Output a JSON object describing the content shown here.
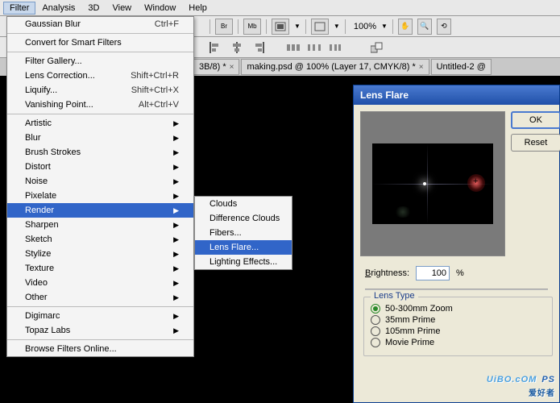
{
  "menubar": {
    "items": [
      "Filter",
      "Analysis",
      "3D",
      "View",
      "Window",
      "Help"
    ],
    "selected": 0
  },
  "toolbar": {
    "buttons": [
      "Br",
      "Mb"
    ],
    "zoom": "100%"
  },
  "doctabs": {
    "tabs": [
      {
        "label": "3B/8) *"
      },
      {
        "label": "making.psd @ 100% (Layer 17, CMYK/8) *"
      },
      {
        "label": "Untitled-2 @"
      }
    ]
  },
  "filter_menu": {
    "last": {
      "label": "Gaussian Blur",
      "shortcut": "Ctrl+F"
    },
    "convert": "Convert for Smart Filters",
    "sec2": [
      {
        "label": "Filter Gallery..."
      },
      {
        "label": "Lens Correction...",
        "shortcut": "Shift+Ctrl+R"
      },
      {
        "label": "Liquify...",
        "shortcut": "Shift+Ctrl+X"
      },
      {
        "label": "Vanishing Point...",
        "shortcut": "Alt+Ctrl+V"
      }
    ],
    "categories": [
      "Artistic",
      "Blur",
      "Brush Strokes",
      "Distort",
      "Noise",
      "Pixelate",
      "Render",
      "Sharpen",
      "Sketch",
      "Stylize",
      "Texture",
      "Video",
      "Other"
    ],
    "selected_category": 6,
    "sec4": [
      "Digimarc",
      "Topaz Labs"
    ],
    "browse": "Browse Filters Online..."
  },
  "render_submenu": {
    "items": [
      "Clouds",
      "Difference Clouds",
      "Fibers...",
      "Lens Flare...",
      "Lighting Effects..."
    ],
    "selected": 3
  },
  "lens_flare_dialog": {
    "title": "Lens Flare",
    "ok": "OK",
    "reset": "Reset",
    "brightness_label": "Brightness:",
    "brightness_value": "100",
    "percent": "%",
    "lens_type_label": "Lens Type",
    "lens_types": [
      "50-300mm Zoom",
      "35mm Prime",
      "105mm Prime",
      "Movie Prime"
    ],
    "selected_lens": 0
  },
  "watermark": {
    "main": "UiBO.cOM",
    "ps": "PS",
    "cn": "爱好者"
  }
}
